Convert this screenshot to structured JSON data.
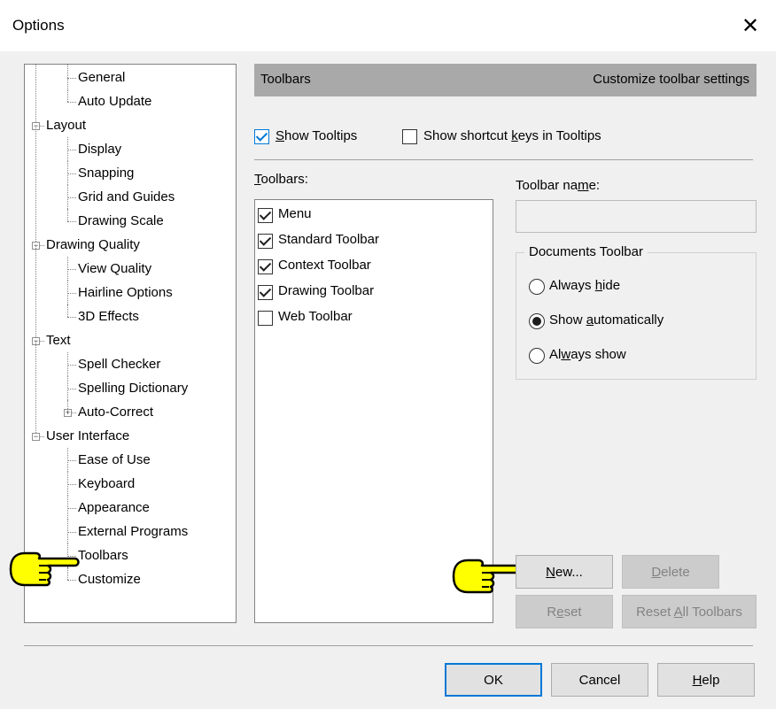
{
  "window": {
    "title": "Options",
    "close_glyph": "✕"
  },
  "tree": {
    "items": [
      {
        "label": "General",
        "level": 1
      },
      {
        "label": "Auto Update",
        "level": 1
      },
      {
        "label": "Layout",
        "level": 0,
        "expander": "−"
      },
      {
        "label": "Display",
        "level": 1
      },
      {
        "label": "Snapping",
        "level": 1
      },
      {
        "label": "Grid and Guides",
        "level": 1
      },
      {
        "label": "Drawing Scale",
        "level": 1
      },
      {
        "label": "Drawing Quality",
        "level": 0,
        "expander": "−"
      },
      {
        "label": "View Quality",
        "level": 1
      },
      {
        "label": "Hairline Options",
        "level": 1
      },
      {
        "label": "3D Effects",
        "level": 1
      },
      {
        "label": "Text",
        "level": 0,
        "expander": "−"
      },
      {
        "label": "Spell Checker",
        "level": 1
      },
      {
        "label": "Spelling Dictionary",
        "level": 1
      },
      {
        "label": "Auto-Correct",
        "level": 1,
        "expander": "+"
      },
      {
        "label": "User Interface",
        "level": 0,
        "expander": "−"
      },
      {
        "label": "Ease of Use",
        "level": 1
      },
      {
        "label": "Keyboard",
        "level": 1
      },
      {
        "label": "Appearance",
        "level": 1
      },
      {
        "label": "External Programs",
        "level": 1
      },
      {
        "label": "Toolbars",
        "level": 1,
        "selected": true
      },
      {
        "label": "Customize",
        "level": 1
      }
    ],
    "scroll_up_glyph": "∧",
    "scroll_down_glyph": "∨"
  },
  "panel": {
    "title": "Toolbars",
    "description": "Customize toolbar settings"
  },
  "options": {
    "show_tooltips": {
      "label_ul": "S",
      "label_rest": "how Tooltips",
      "checked": true
    },
    "show_shortcut_keys": {
      "label_pre": "Show shortcut ",
      "label_ul": "k",
      "label_rest": "eys in Tooltips",
      "checked": false
    }
  },
  "toolbars_list": {
    "label_ul": "T",
    "label_rest": "oolbars:",
    "items": [
      {
        "label": "Menu",
        "checked": true
      },
      {
        "label": "Standard Toolbar",
        "checked": true
      },
      {
        "label": "Context Toolbar",
        "checked": true
      },
      {
        "label": "Drawing Toolbar",
        "checked": true
      },
      {
        "label": "Web Toolbar",
        "checked": false
      }
    ]
  },
  "toolbar_name": {
    "label_pre": "Toolbar na",
    "label_ul": "m",
    "label_rest": "e:",
    "value": ""
  },
  "documents_toolbar": {
    "legend": "Documents Toolbar",
    "radios": [
      {
        "pre": "Always ",
        "ul": "h",
        "rest": "ide",
        "selected": false
      },
      {
        "pre": "Show ",
        "ul": "a",
        "rest": "utomatically",
        "selected": true
      },
      {
        "pre": "Al",
        "ul": "w",
        "rest": "ays show",
        "selected": false
      }
    ]
  },
  "buttons": {
    "new": {
      "ul": "N",
      "rest": "ew..."
    },
    "delete": {
      "ul": "D",
      "rest": "elete"
    },
    "reset": {
      "pre": "R",
      "ul": "e",
      "rest": "set"
    },
    "reset_all": {
      "pre": "Reset ",
      "ul": "A",
      "rest": "ll Toolbars"
    },
    "ok": "OK",
    "cancel": "Cancel",
    "help": {
      "ul": "H",
      "rest": "elp"
    }
  },
  "colors": {
    "header_band": "#a9a9a9",
    "hand_pointer": "#ffff00",
    "accent": "#0078d7"
  }
}
